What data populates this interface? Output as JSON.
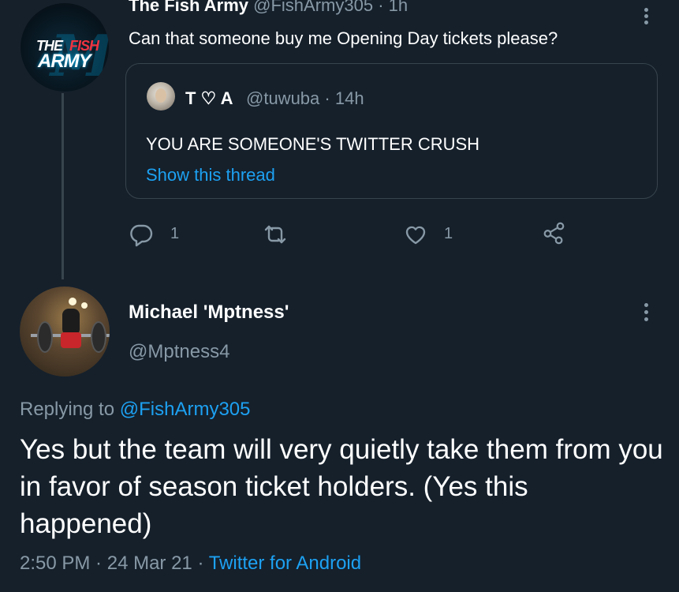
{
  "colors": {
    "background": "#15202b",
    "primary_text": "#ffffff",
    "secondary_text": "#8899a6",
    "link": "#1da1f2",
    "divider": "#38444d",
    "marlins_red": "#ef3340"
  },
  "tweet1": {
    "avatar_logo": {
      "the": "THE",
      "fish": "FISH",
      "army": "ARMY",
      "mark": "M"
    },
    "name": "The Fish Army",
    "handle": "@FishArmy305",
    "separator": "·",
    "time": "1h",
    "text": "Can that someone buy me Opening Day tickets please?",
    "more_icon": "more-vertical-icon"
  },
  "quoted_tweet": {
    "name": "T ♡ A",
    "handle": "@tuwuba",
    "separator": "·",
    "time": "14h",
    "text": "YOU ARE SOMEONE'S TWITTER CRUSH",
    "show_thread": "Show this thread"
  },
  "actions": {
    "reply": {
      "icon": "reply-icon",
      "count": "1"
    },
    "retweet": {
      "icon": "retweet-icon",
      "count": ""
    },
    "like": {
      "icon": "heart-icon",
      "count": "1"
    },
    "share": {
      "icon": "share-icon"
    }
  },
  "tweet2": {
    "name": "Michael 'Mptness'",
    "handle": "@Mptness4",
    "replying_prefix": "Replying to ",
    "replying_handle": "@FishArmy305",
    "text": "Yes but the team will very quietly take them from you in favor of season ticket holders. (Yes this happened)",
    "time": "2:50 PM",
    "separator": " · ",
    "date": "24 Mar 21",
    "separator2": " · ",
    "source": "Twitter for Android",
    "more_icon": "more-vertical-icon"
  }
}
